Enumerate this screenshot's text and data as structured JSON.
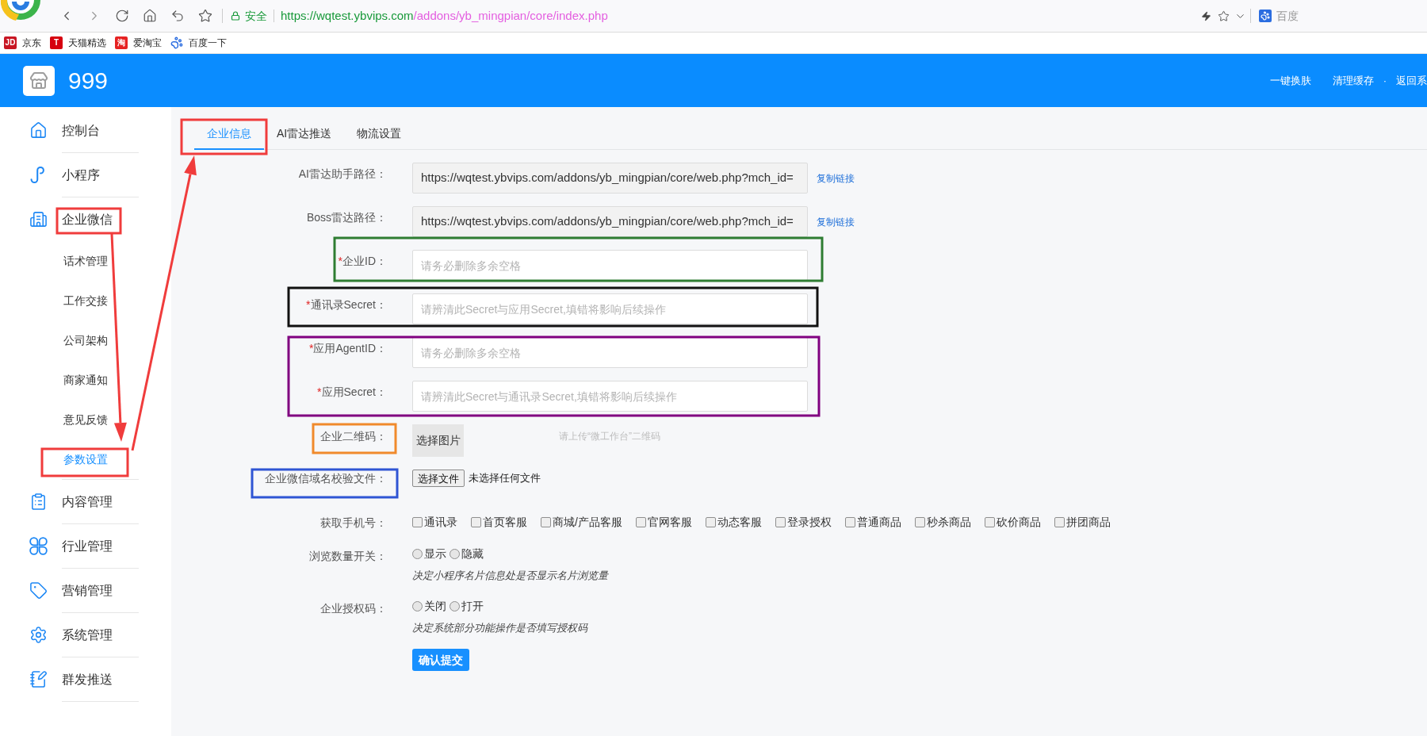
{
  "browser": {
    "security_label": "安全",
    "url": {
      "host": "https://wqtest.ybvips.com",
      "path": "/addons/yb_mingpian/core/index.php"
    },
    "search": {
      "placeholder": "百度"
    }
  },
  "bookmarks": [
    {
      "kind": "letter",
      "badge": "JD",
      "color": "#c81623",
      "label": "京东"
    },
    {
      "kind": "letter",
      "badge": "T",
      "color": "#d6000f",
      "label": "天猫精选"
    },
    {
      "kind": "letter",
      "badge": "淘",
      "color": "#e62222",
      "label": "爱淘宝"
    },
    {
      "kind": "paw",
      "label": "百度一下"
    }
  ],
  "header": {
    "title": "999",
    "links": [
      {
        "kind": "link",
        "label": "一键换肤"
      },
      {
        "kind": "link",
        "label": "清理缓存"
      },
      {
        "kind": "separator",
        "label": "·"
      },
      {
        "kind": "link",
        "label": "返回系"
      }
    ]
  },
  "sidebar": {
    "items": [
      {
        "label": "控制台",
        "selected": false
      },
      {
        "label": "小程序",
        "selected": false
      },
      {
        "label": "企业微信",
        "selected": false,
        "expanded": true,
        "children": [
          {
            "label": "话术管理",
            "selected": false
          },
          {
            "label": "工作交接",
            "selected": false
          },
          {
            "label": "公司架构",
            "selected": false
          },
          {
            "label": "商家通知",
            "selected": false
          },
          {
            "label": "意见反馈",
            "selected": false
          },
          {
            "label": "参数设置",
            "selected": true
          }
        ]
      },
      {
        "label": "内容管理",
        "selected": false
      },
      {
        "label": "行业管理",
        "selected": false
      },
      {
        "label": "营销管理",
        "selected": false
      },
      {
        "label": "系统管理",
        "selected": false
      },
      {
        "label": "群发推送",
        "selected": false
      }
    ]
  },
  "tabs": [
    {
      "label": "企业信息",
      "selected": true
    },
    {
      "label": "AI雷达推送",
      "selected": false
    },
    {
      "label": "物流设置",
      "selected": false
    }
  ],
  "form": {
    "rows": [
      {
        "kind": "readonly",
        "label": "AI雷达助手路径：",
        "value": "https://wqtest.ybvips.com/addons/yb_mingpian/core/web.php?mch_id=",
        "link": "复制链接"
      },
      {
        "kind": "readonly",
        "label": "Boss雷达路径：",
        "value": "https://wqtest.ybvips.com/addons/yb_mingpian/core/web.php?mch_id=",
        "link": "复制链接"
      },
      {
        "kind": "text",
        "required_mark": "*",
        "label": "企业ID：",
        "placeholder": "请务必删除多余空格"
      },
      {
        "kind": "text",
        "required_mark": "*",
        "label": "通讯录Secret：",
        "placeholder": "请辨清此Secret与应用Secret,填错将影响后续操作"
      },
      {
        "kind": "text",
        "required_mark": "*",
        "label": "应用AgentID：",
        "placeholder": "请务必删除多余空格"
      },
      {
        "kind": "text",
        "required_mark": "*",
        "label": "应用Secret：",
        "placeholder": "请辨清此Secret与通讯录Secret,填错将影响后续操作"
      },
      {
        "kind": "image",
        "label": "企业二维码：",
        "button": "选择图片",
        "hint": "请上传“微工作台”二维码"
      },
      {
        "kind": "file",
        "label": "企业微信域名校验文件：",
        "button": "选择文件",
        "status": "未选择任何文件"
      },
      {
        "kind": "checkboxes",
        "label": "获取手机号：",
        "options": [
          {
            "label": "通讯录",
            "checked": false
          },
          {
            "label": "首页客服",
            "checked": false
          },
          {
            "label": "商城/产品客服",
            "checked": false
          },
          {
            "label": "官网客服",
            "checked": false
          },
          {
            "label": "动态客服",
            "checked": false
          },
          {
            "label": "登录授权",
            "checked": false
          },
          {
            "label": "普通商品",
            "checked": false
          },
          {
            "label": "秒杀商品",
            "checked": false
          },
          {
            "label": "砍价商品",
            "checked": false
          },
          {
            "label": "拼团商品",
            "checked": false
          }
        ]
      },
      {
        "kind": "radios",
        "label": "浏览数量开关：",
        "options": [
          {
            "label": "显示",
            "selected": false
          },
          {
            "label": "隐藏",
            "selected": false
          }
        ],
        "hint": "决定小程序名片信息处是否显示名片浏览量"
      },
      {
        "kind": "radios",
        "label": "企业授权码：",
        "options": [
          {
            "label": "关闭",
            "selected": false
          },
          {
            "label": "打开",
            "selected": false
          }
        ],
        "hint": "决定系统部分功能操作是否填写授权码"
      }
    ],
    "submit": "确认提交"
  },
  "annotations": [
    {
      "kind": "frame",
      "color": "#f03c3c"
    },
    {
      "kind": "frame",
      "color": "#f03c3c"
    },
    {
      "kind": "frame",
      "color": "#f03c3c"
    },
    {
      "kind": "frame",
      "color": "#2e7d32"
    },
    {
      "kind": "frame",
      "color": "#111111"
    },
    {
      "kind": "frame",
      "color": "#800080"
    },
    {
      "kind": "frame",
      "color": "#f08a2c"
    },
    {
      "kind": "frame",
      "color": "#2f55d4"
    },
    {
      "kind": "arrow",
      "color": "#f03c3c"
    },
    {
      "kind": "arrow",
      "color": "#f03c3c"
    }
  ]
}
